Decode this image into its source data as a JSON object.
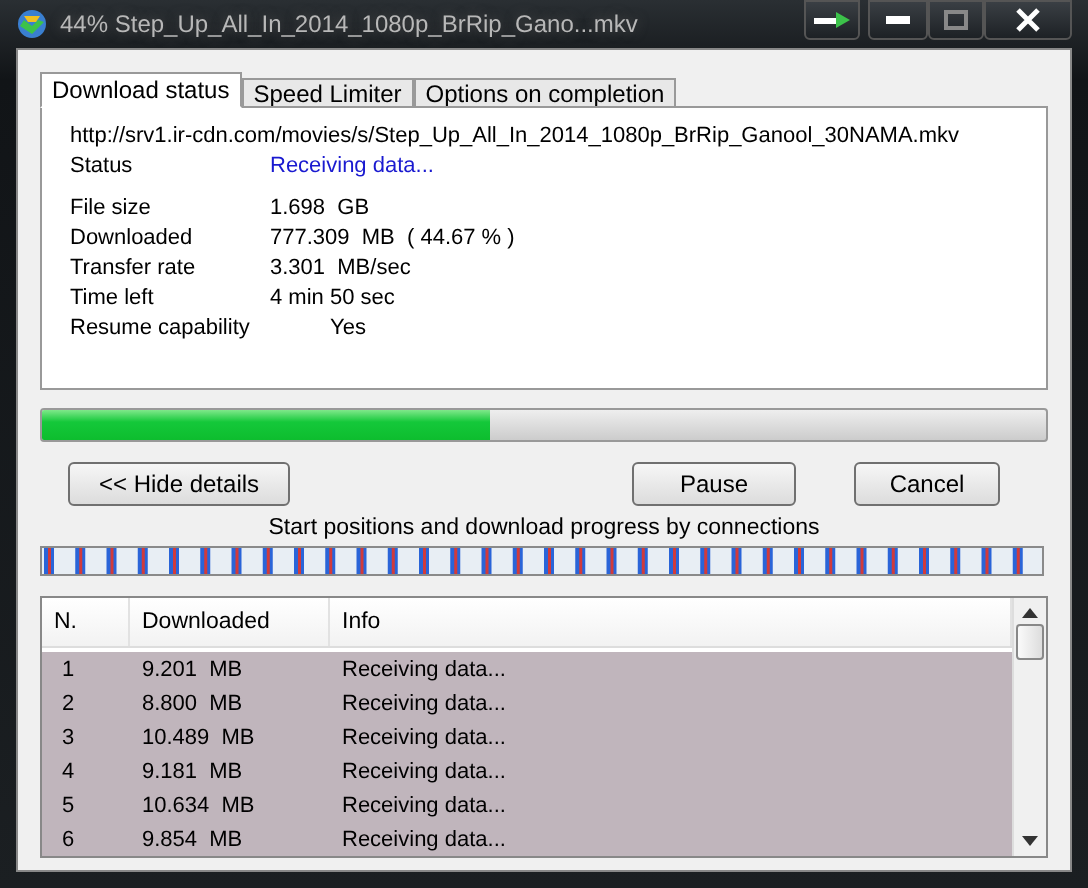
{
  "window": {
    "title": "44% Step_Up_All_In_2014_1080p_BrRip_Gano...mkv"
  },
  "tabs": [
    {
      "label": "Download status",
      "selected": true
    },
    {
      "label": "Speed Limiter",
      "selected": false
    },
    {
      "label": "Options on completion",
      "selected": false
    }
  ],
  "details": {
    "url": "http://srv1.ir-cdn.com/movies/s/Step_Up_All_In_2014_1080p_BrRip_Ganool_30NAMA.mkv",
    "status_label": "Status",
    "status": "Receiving data...",
    "fields": [
      {
        "label": "File size",
        "value": "1.698  GB"
      },
      {
        "label": "Downloaded",
        "value": "777.309  MB  ( 44.67 % )"
      },
      {
        "label": "Transfer rate",
        "value": "3.301  MB/sec"
      },
      {
        "label": "Time left",
        "value": "4 min 50 sec"
      },
      {
        "label": "Resume capability",
        "value": "Yes",
        "indented": true
      }
    ]
  },
  "progress": {
    "level": 0.4467
  },
  "buttons": {
    "hide_details": "<< Hide details",
    "pause": "Pause",
    "cancel": "Cancel"
  },
  "connections_caption": "Start positions and download progress by connections",
  "table": {
    "columns": [
      "N.",
      "Downloaded",
      "Info"
    ],
    "rows": [
      {
        "n": "1",
        "downloaded": "9.201  MB",
        "info": "Receiving data...",
        "selected": true
      },
      {
        "n": "2",
        "downloaded": "8.800  MB",
        "info": "Receiving data...",
        "selected": true
      },
      {
        "n": "3",
        "downloaded": "10.489  MB",
        "info": "Receiving data...",
        "selected": true
      },
      {
        "n": "4",
        "downloaded": "9.181  MB",
        "info": "Receiving data...",
        "selected": true
      },
      {
        "n": "5",
        "downloaded": "10.634  MB",
        "info": "Receiving data...",
        "selected": true
      },
      {
        "n": "6",
        "downloaded": "9.854  MB",
        "info": "Receiving data...",
        "selected": true
      }
    ]
  }
}
